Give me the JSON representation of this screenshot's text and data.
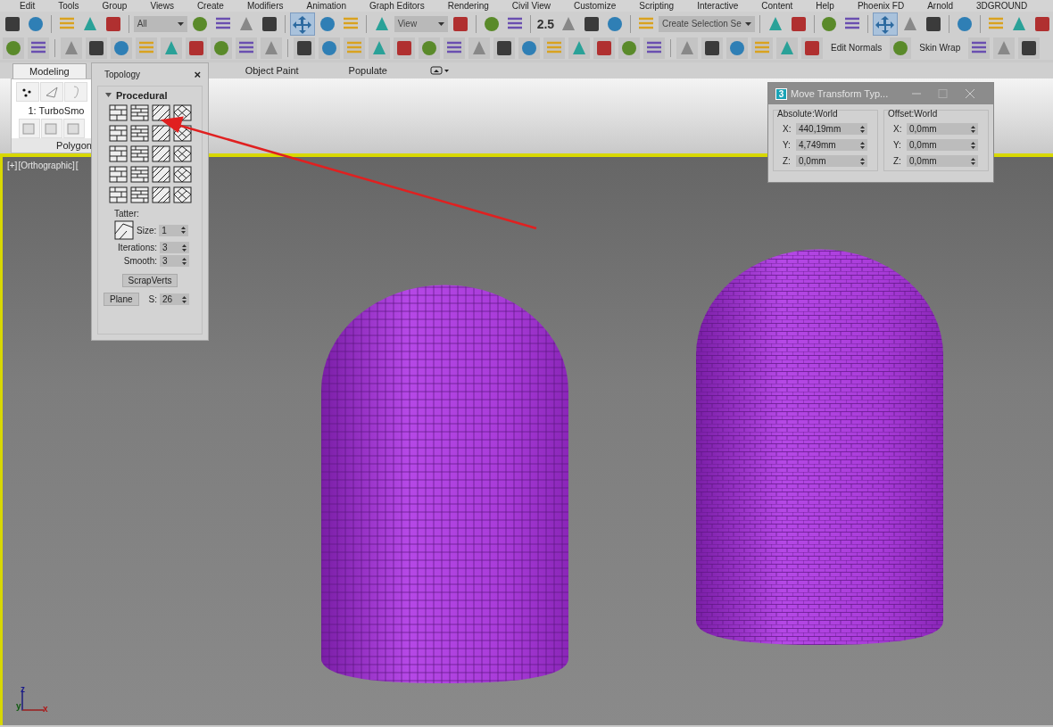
{
  "menu_bar": [
    "Edit",
    "Tools",
    "Group",
    "Views",
    "Create",
    "Modifiers",
    "Animation",
    "Graph Editors",
    "Rendering",
    "Civil View",
    "Customize",
    "Scripting",
    "Interactive",
    "Content",
    "Help",
    "Phoenix FD",
    "Arnold",
    "3DGROUND"
  ],
  "toolbar": {
    "selection_filter": "All",
    "reference_coordinate": "View",
    "named_selection": "Create Selection Se",
    "snap_label": "2.5",
    "text_buttons": [
      "Edit Normals",
      "Skin Wrap"
    ]
  },
  "ribbon": {
    "tabs": [
      {
        "label": "Modeling",
        "selected": true
      },
      {
        "label": "Object Paint",
        "selected": false
      },
      {
        "label": "Populate",
        "selected": false
      }
    ],
    "modifier": "1: TurboSmo",
    "panel_label": "Polygon"
  },
  "topology": {
    "title": "Topology",
    "close": "×",
    "section": "Procedural",
    "tatter_label": "Tatter:",
    "size_label": "Size:",
    "size": "1",
    "iterations_label": "Iterations:",
    "iterations": "3",
    "smooth_label": "Smooth:",
    "smooth": "3",
    "scrap_button": "ScrapVerts",
    "plane_button": "Plane",
    "s_label": "S:",
    "s_value": "26"
  },
  "viewport": {
    "labels": [
      "[+]",
      "[Orthographic]",
      "["
    ],
    "axes": [
      "z",
      "x",
      "y"
    ]
  },
  "dialog": {
    "badge": "3",
    "title": "Move Transform Typ...",
    "groups": [
      {
        "title": "Absolute:World",
        "fields": [
          {
            "axis": "X:",
            "value": "440,19mm"
          },
          {
            "axis": "Y:",
            "value": "4,749mm"
          },
          {
            "axis": "Z:",
            "value": "0,0mm"
          }
        ]
      },
      {
        "title": "Offset:World",
        "fields": [
          {
            "axis": "X:",
            "value": "0,0mm"
          },
          {
            "axis": "Y:",
            "value": "0,0mm"
          },
          {
            "axis": "Z:",
            "value": "0,0mm"
          }
        ]
      }
    ]
  }
}
